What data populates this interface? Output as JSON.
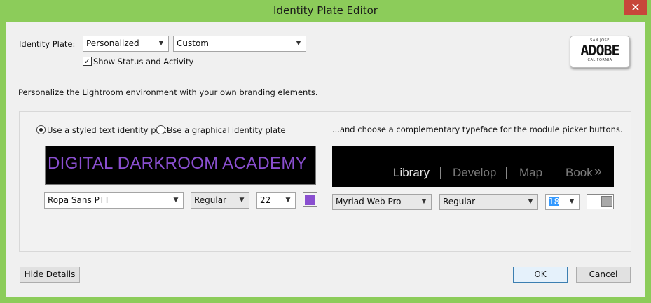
{
  "window": {
    "title": "Identity Plate Editor",
    "close_glyph": "✕"
  },
  "identity_plate": {
    "label": "Identity Plate:",
    "type_value": "Personalized",
    "preset_value": "Custom",
    "show_status_label": "Show Status and Activity",
    "show_status_checked": true
  },
  "plate_badge": {
    "top": "SAN JOSE",
    "main": "ADOBE",
    "bottom": "CALIFORNIA"
  },
  "description": "Personalize the Lightroom environment with your own branding elements.",
  "left_panel": {
    "radio_styled_label": "Use a styled text identity plate",
    "radio_graphical_label": "Use a graphical identity plate",
    "preview_text": "DIGITAL DARKROOM ACADEMY",
    "font_value": "Ropa Sans PTT",
    "style_value": "Regular",
    "size_value": "22",
    "text_color": "#8a4fd0"
  },
  "right_panel": {
    "heading": "...and choose a complementary typeface for the module picker buttons.",
    "modules": [
      "Library",
      "Develop",
      "Map",
      "Book"
    ],
    "more_glyph": "»",
    "font_value": "Myriad Web Pro",
    "style_value": "Regular",
    "size_value": "18"
  },
  "footer": {
    "hide_details": "Hide Details",
    "ok": "OK",
    "cancel": "Cancel"
  },
  "colors": {
    "accent_purple": "#8a4fd0",
    "title_bar": "#8ccc5a",
    "close_button": "#c7463a"
  }
}
